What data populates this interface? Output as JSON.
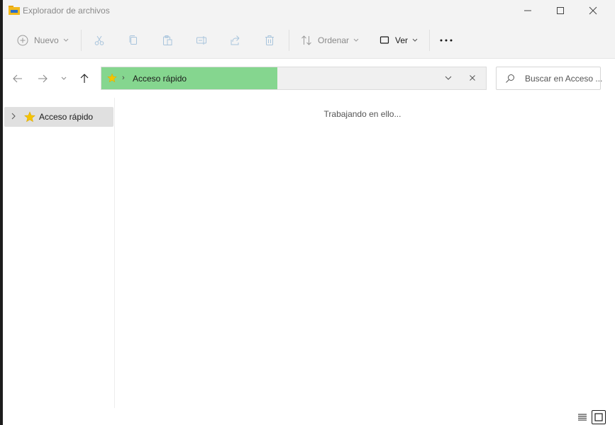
{
  "window": {
    "title": "Explorador de archivos"
  },
  "toolbar": {
    "new_label": "Nuevo",
    "sort_label": "Ordenar",
    "view_label": "Ver"
  },
  "address": {
    "location": "Acceso rápido"
  },
  "search": {
    "placeholder": "Buscar en Acceso ..."
  },
  "navigation": {
    "items": [
      {
        "label": "Acceso rápido"
      }
    ]
  },
  "content": {
    "status": "Trabajando en ello..."
  },
  "colors": {
    "address_progress": "#85d68f",
    "star": "#f5c400",
    "folder": "#f2b91b"
  }
}
